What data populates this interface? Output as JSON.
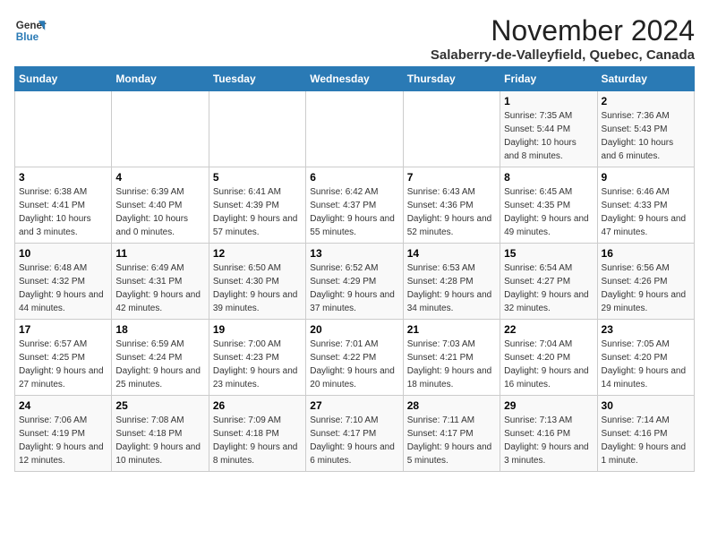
{
  "logo": {
    "line1": "General",
    "line2": "Blue"
  },
  "title": "November 2024",
  "location": "Salaberry-de-Valleyfield, Quebec, Canada",
  "days_of_week": [
    "Sunday",
    "Monday",
    "Tuesday",
    "Wednesday",
    "Thursday",
    "Friday",
    "Saturday"
  ],
  "weeks": [
    [
      {
        "day": "",
        "info": ""
      },
      {
        "day": "",
        "info": ""
      },
      {
        "day": "",
        "info": ""
      },
      {
        "day": "",
        "info": ""
      },
      {
        "day": "",
        "info": ""
      },
      {
        "day": "1",
        "info": "Sunrise: 7:35 AM\nSunset: 5:44 PM\nDaylight: 10 hours and 8 minutes."
      },
      {
        "day": "2",
        "info": "Sunrise: 7:36 AM\nSunset: 5:43 PM\nDaylight: 10 hours and 6 minutes."
      }
    ],
    [
      {
        "day": "3",
        "info": "Sunrise: 6:38 AM\nSunset: 4:41 PM\nDaylight: 10 hours and 3 minutes."
      },
      {
        "day": "4",
        "info": "Sunrise: 6:39 AM\nSunset: 4:40 PM\nDaylight: 10 hours and 0 minutes."
      },
      {
        "day": "5",
        "info": "Sunrise: 6:41 AM\nSunset: 4:39 PM\nDaylight: 9 hours and 57 minutes."
      },
      {
        "day": "6",
        "info": "Sunrise: 6:42 AM\nSunset: 4:37 PM\nDaylight: 9 hours and 55 minutes."
      },
      {
        "day": "7",
        "info": "Sunrise: 6:43 AM\nSunset: 4:36 PM\nDaylight: 9 hours and 52 minutes."
      },
      {
        "day": "8",
        "info": "Sunrise: 6:45 AM\nSunset: 4:35 PM\nDaylight: 9 hours and 49 minutes."
      },
      {
        "day": "9",
        "info": "Sunrise: 6:46 AM\nSunset: 4:33 PM\nDaylight: 9 hours and 47 minutes."
      }
    ],
    [
      {
        "day": "10",
        "info": "Sunrise: 6:48 AM\nSunset: 4:32 PM\nDaylight: 9 hours and 44 minutes."
      },
      {
        "day": "11",
        "info": "Sunrise: 6:49 AM\nSunset: 4:31 PM\nDaylight: 9 hours and 42 minutes."
      },
      {
        "day": "12",
        "info": "Sunrise: 6:50 AM\nSunset: 4:30 PM\nDaylight: 9 hours and 39 minutes."
      },
      {
        "day": "13",
        "info": "Sunrise: 6:52 AM\nSunset: 4:29 PM\nDaylight: 9 hours and 37 minutes."
      },
      {
        "day": "14",
        "info": "Sunrise: 6:53 AM\nSunset: 4:28 PM\nDaylight: 9 hours and 34 minutes."
      },
      {
        "day": "15",
        "info": "Sunrise: 6:54 AM\nSunset: 4:27 PM\nDaylight: 9 hours and 32 minutes."
      },
      {
        "day": "16",
        "info": "Sunrise: 6:56 AM\nSunset: 4:26 PM\nDaylight: 9 hours and 29 minutes."
      }
    ],
    [
      {
        "day": "17",
        "info": "Sunrise: 6:57 AM\nSunset: 4:25 PM\nDaylight: 9 hours and 27 minutes."
      },
      {
        "day": "18",
        "info": "Sunrise: 6:59 AM\nSunset: 4:24 PM\nDaylight: 9 hours and 25 minutes."
      },
      {
        "day": "19",
        "info": "Sunrise: 7:00 AM\nSunset: 4:23 PM\nDaylight: 9 hours and 23 minutes."
      },
      {
        "day": "20",
        "info": "Sunrise: 7:01 AM\nSunset: 4:22 PM\nDaylight: 9 hours and 20 minutes."
      },
      {
        "day": "21",
        "info": "Sunrise: 7:03 AM\nSunset: 4:21 PM\nDaylight: 9 hours and 18 minutes."
      },
      {
        "day": "22",
        "info": "Sunrise: 7:04 AM\nSunset: 4:20 PM\nDaylight: 9 hours and 16 minutes."
      },
      {
        "day": "23",
        "info": "Sunrise: 7:05 AM\nSunset: 4:20 PM\nDaylight: 9 hours and 14 minutes."
      }
    ],
    [
      {
        "day": "24",
        "info": "Sunrise: 7:06 AM\nSunset: 4:19 PM\nDaylight: 9 hours and 12 minutes."
      },
      {
        "day": "25",
        "info": "Sunrise: 7:08 AM\nSunset: 4:18 PM\nDaylight: 9 hours and 10 minutes."
      },
      {
        "day": "26",
        "info": "Sunrise: 7:09 AM\nSunset: 4:18 PM\nDaylight: 9 hours and 8 minutes."
      },
      {
        "day": "27",
        "info": "Sunrise: 7:10 AM\nSunset: 4:17 PM\nDaylight: 9 hours and 6 minutes."
      },
      {
        "day": "28",
        "info": "Sunrise: 7:11 AM\nSunset: 4:17 PM\nDaylight: 9 hours and 5 minutes."
      },
      {
        "day": "29",
        "info": "Sunrise: 7:13 AM\nSunset: 4:16 PM\nDaylight: 9 hours and 3 minutes."
      },
      {
        "day": "30",
        "info": "Sunrise: 7:14 AM\nSunset: 4:16 PM\nDaylight: 9 hours and 1 minute."
      }
    ]
  ]
}
